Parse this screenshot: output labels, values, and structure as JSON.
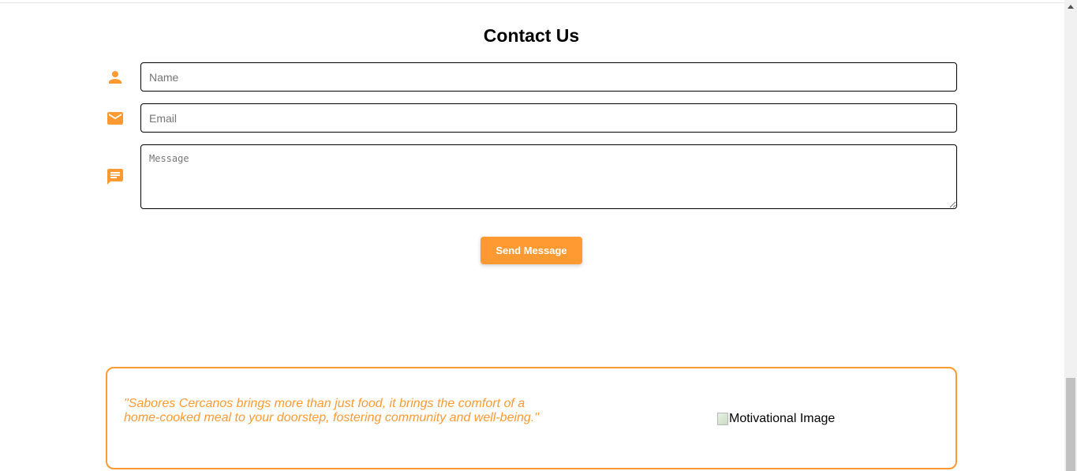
{
  "contact": {
    "title": "Contact Us",
    "name_placeholder": "Name",
    "email_placeholder": "Email",
    "message_placeholder": "Message",
    "send_label": "Send Message"
  },
  "icons": {
    "name": "person-icon",
    "email": "envelope-icon",
    "message": "chat-message-icon"
  },
  "quote": {
    "text": "\"Sabores Cercanos brings more than just food, it brings the comfort of a home-cooked meal to your doorstep, fostering community and well-being.\"",
    "image_alt": "Motivational Image"
  },
  "colors": {
    "accent": "#ff9a33",
    "text": "#000000",
    "field_border": "#000000"
  }
}
